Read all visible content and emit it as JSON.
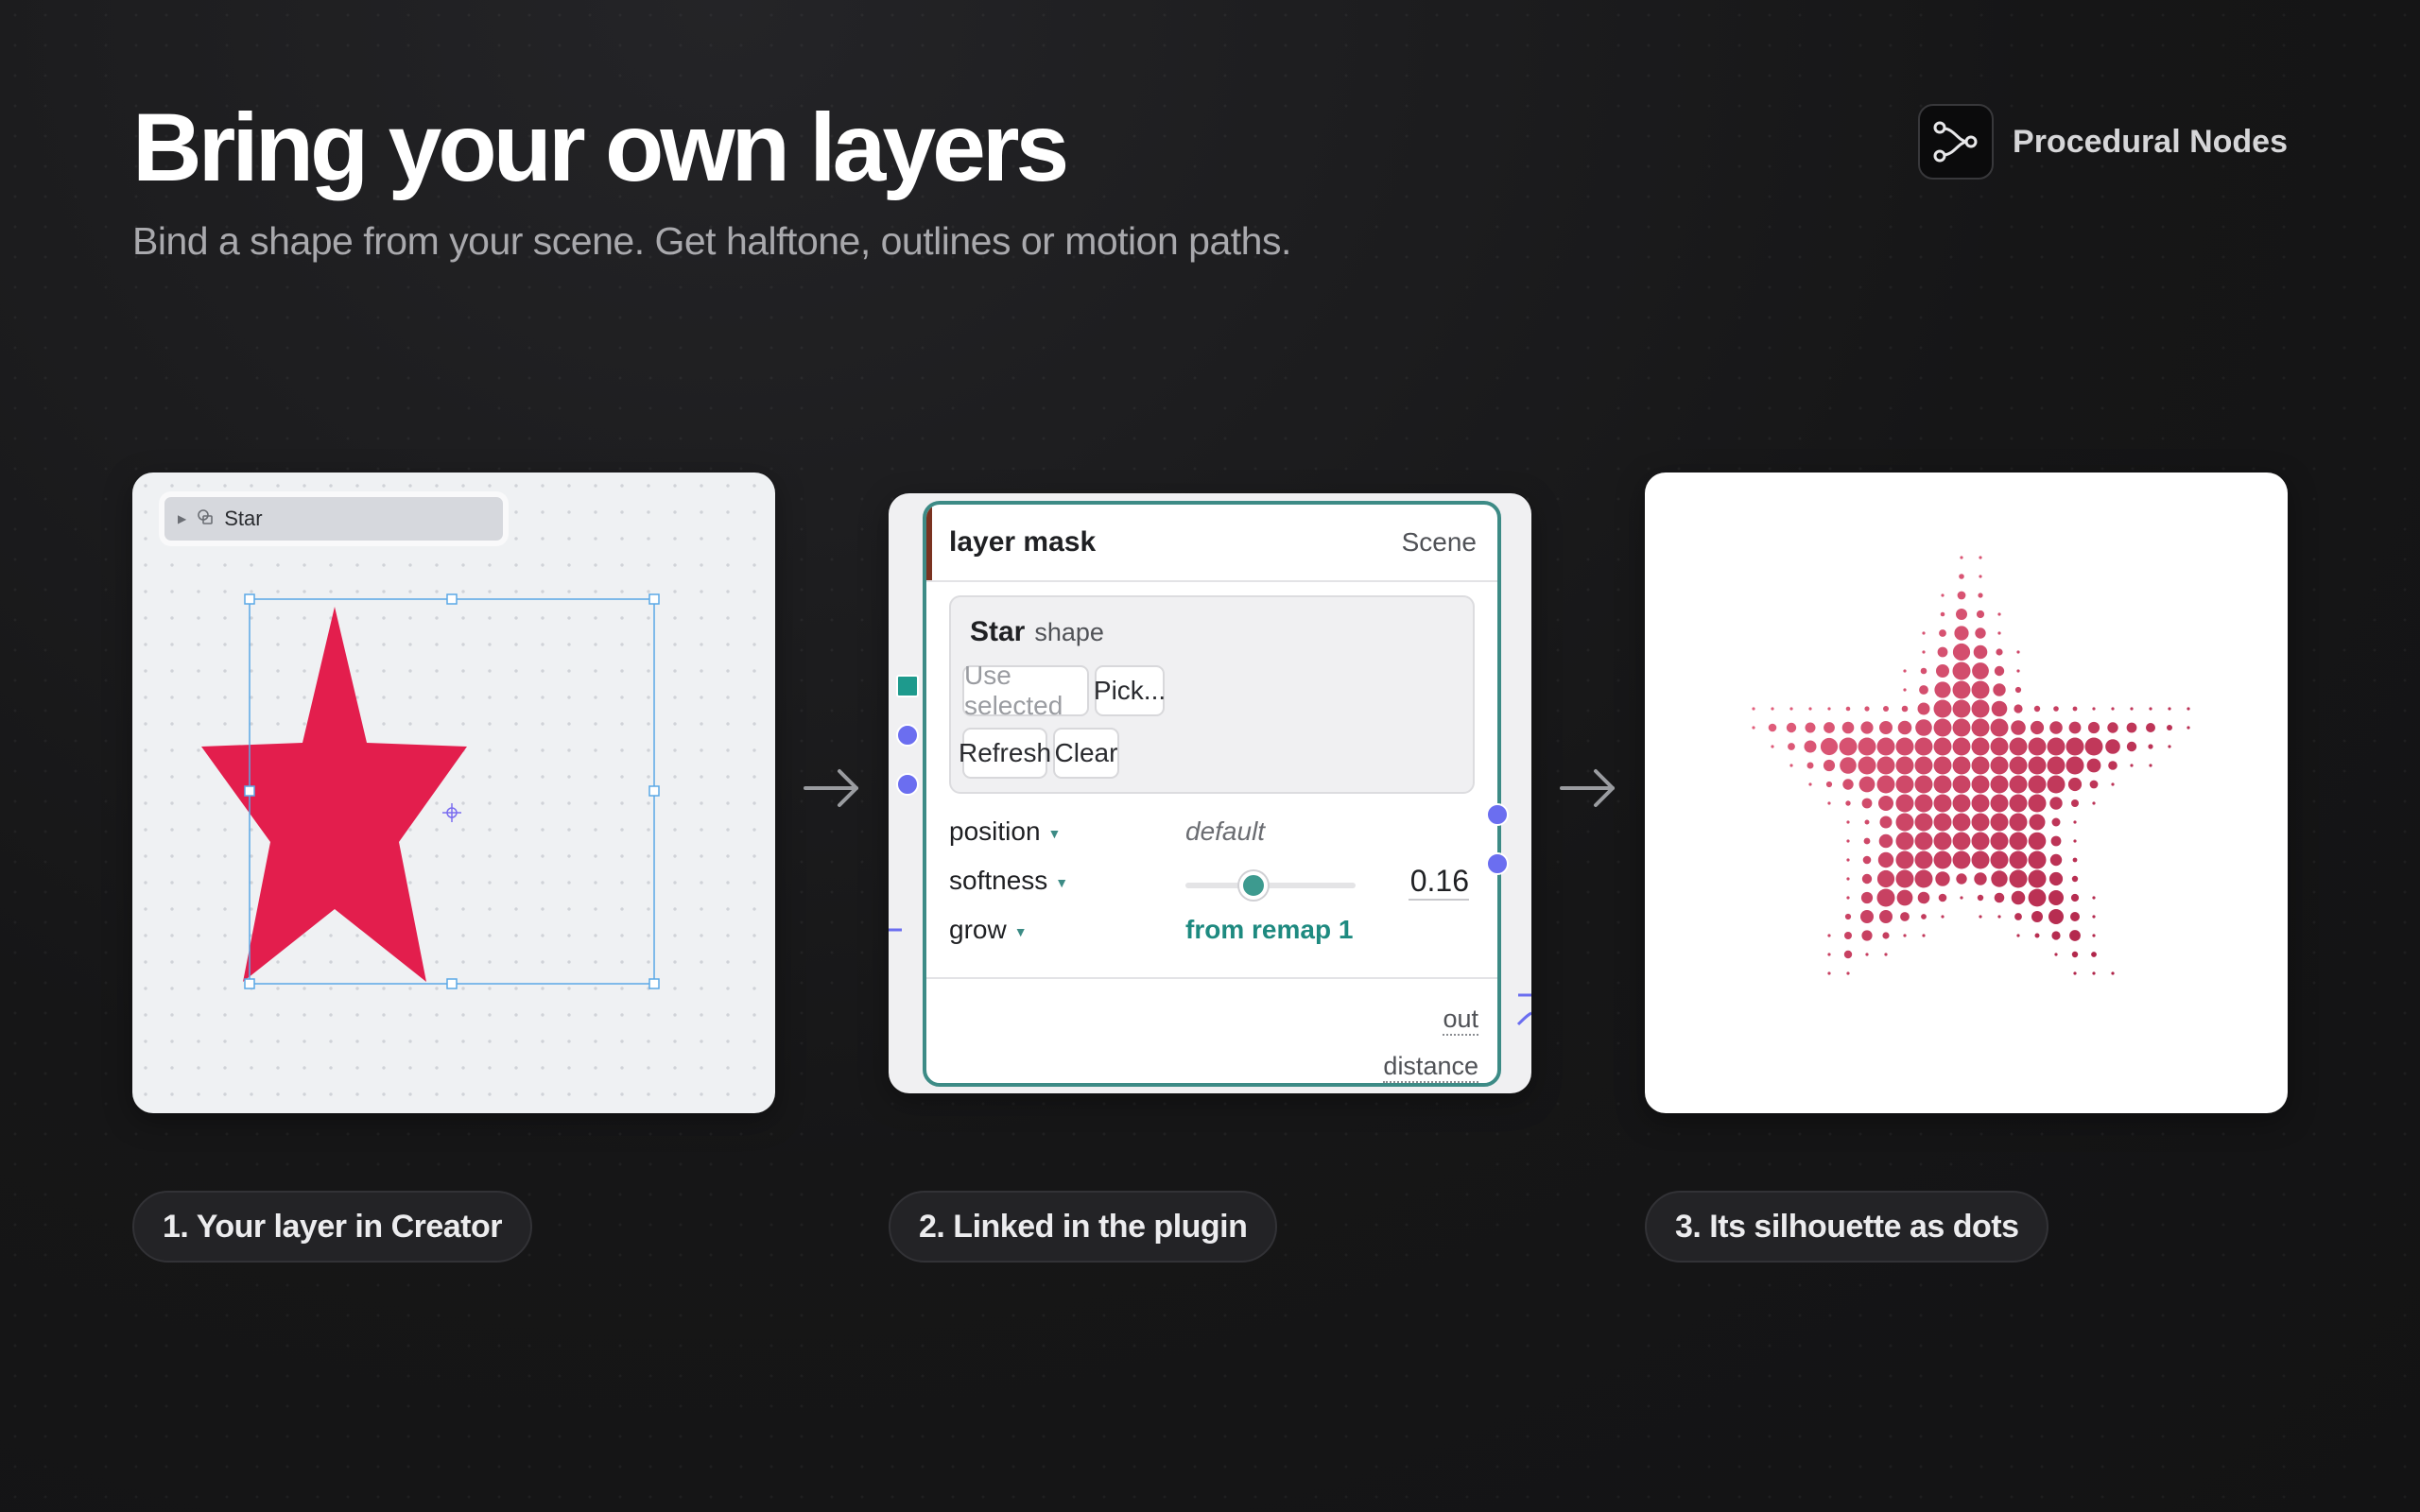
{
  "header": {
    "title": "Bring your own layers",
    "subtitle": "Bind a shape from your scene. Get halftone, outlines or motion paths."
  },
  "brand": {
    "name": "Procedural Nodes",
    "icon": "node-graph-icon"
  },
  "creator": {
    "layer_name": "Star",
    "star_color": "#e31e4d",
    "selection_color": "#5aa8e6"
  },
  "plugin": {
    "node_title": "layer mask",
    "node_source": "Scene",
    "shape": {
      "name": "Star",
      "kind": "shape",
      "buttons": {
        "use_selected": "Use selected",
        "pick": "Pick...",
        "refresh": "Refresh",
        "clear": "Clear"
      }
    },
    "params": {
      "position": {
        "label": "position",
        "value": "default"
      },
      "softness": {
        "label": "softness",
        "value": "0.16"
      },
      "grow": {
        "label": "grow",
        "value": "from remap 1"
      }
    },
    "outputs": {
      "out": "out",
      "distance": "distance"
    },
    "accent_color": "#3d8b86",
    "socket_color": "#6b6ef0"
  },
  "result": {
    "dot_color_light": "#ef6f8a",
    "dot_color_dark": "#a3153c"
  },
  "captions": {
    "step1": "1. Your layer in Creator",
    "step2": "2. Linked in the plugin",
    "step3": "3. Its silhouette as dots"
  }
}
